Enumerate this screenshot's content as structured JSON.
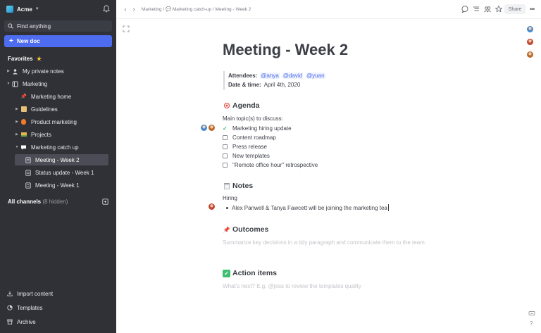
{
  "workspace": {
    "name": "Acme"
  },
  "sidebar": {
    "search_label": "Find anything",
    "new_doc_label": "New doc",
    "favorites_label": "Favorites",
    "favorites_items": [
      {
        "label": "My private notes"
      },
      {
        "label": "Marketing"
      },
      {
        "label": "Marketing home"
      },
      {
        "label": "Guidelines"
      },
      {
        "label": "Product marketing"
      },
      {
        "label": "Projects"
      },
      {
        "label": "Marketing catch up"
      },
      {
        "label": "Meeting - Week 2"
      },
      {
        "label": "Status update - Week 1"
      },
      {
        "label": "Meeting - Week 1"
      }
    ],
    "all_channels_label": "All channels",
    "hidden_count": "(8 hidden)",
    "bottom": {
      "import": "Import content",
      "templates": "Templates",
      "archive": "Archive"
    }
  },
  "topbar": {
    "breadcrumb": "Marketing / 💬 Marketing catch-up / Meeting - Week 2",
    "share_label": "Share",
    "more_label": "•••"
  },
  "doc": {
    "title": "Meeting - Week 2",
    "attendees_label": "Attendees:",
    "attendees": [
      "@anya",
      "@david",
      "@yuan"
    ],
    "date_label": "Date & time:",
    "date_value": "April 4th, 2020",
    "agenda_heading": "Agenda",
    "agenda_intro": "Main topic(s) to discuss:",
    "todos": [
      {
        "label": "Marketing hiring update",
        "done": true
      },
      {
        "label": "Content roadmap",
        "done": false
      },
      {
        "label": "Press release",
        "done": false
      },
      {
        "label": "New templates",
        "done": false
      },
      {
        "label": "\"Remote office hour\" retrospective",
        "done": false
      }
    ],
    "notes_heading": "Notes",
    "notes_sub": "Hiring",
    "notes_bullet": "Alex Panwell & Tanya Fawcett will be joining the marketing tea",
    "outcomes_heading": "Outcomes",
    "outcomes_placeholder": "Summarize key decisions in a tidy paragraph and communicate them to the team.",
    "action_heading": "Action items",
    "action_placeholder": "What's next? E.g. @jess to review the templates quality"
  },
  "help_label": "?",
  "colors": {
    "accent": "#4e6cf0",
    "sidebar_bg": "#2f3136",
    "check": "#3fbf72"
  }
}
